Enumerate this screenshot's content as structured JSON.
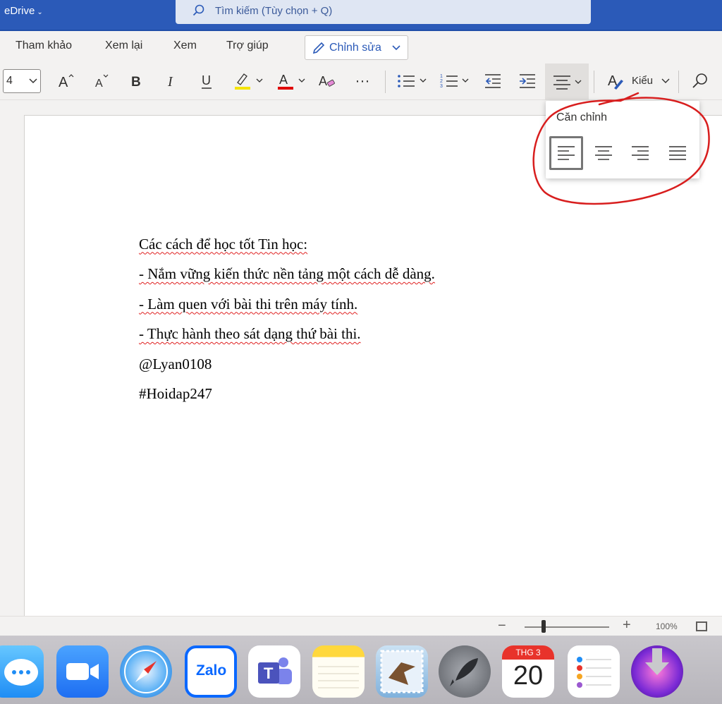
{
  "titlebar": {
    "app_name": "eDrive",
    "search_placeholder": "Tìm kiếm (Tùy chọn + Q)"
  },
  "tabs": [
    "Tham khảo",
    "Xem lại",
    "Xem",
    "Trợ giúp"
  ],
  "edit_mode": {
    "label": "Chỉnh sửa"
  },
  "toolbar": {
    "font_size": "4",
    "more_label": "···",
    "styles_label": "Kiểu"
  },
  "alignment_popup": {
    "title": "Căn chỉnh",
    "options": [
      "align-left",
      "align-center",
      "align-right",
      "justify"
    ],
    "selected": "align-left"
  },
  "document": {
    "lines": [
      "Các cách để học tốt Tin học:",
      "- Nắm vững kiến thức nền tảng một cách dễ dàng.",
      "- Làm quen với bài thi trên máy tính.",
      "- Thực hành theo sát dạng thứ bài thi.",
      "@Lyan0108",
      "#Hoidap247"
    ]
  },
  "status": {
    "zoom_label": "100%",
    "zoom_level_percent": 100
  },
  "dock": {
    "apps": [
      "Messages",
      "Zoom",
      "Safari",
      "Zalo",
      "Teams",
      "Notes",
      "Mail",
      "Launchpad",
      "Calendar",
      "Reminders",
      "Downloader"
    ],
    "zalo_label": "Zalo",
    "calendar_month": "THG 3",
    "calendar_day": "20"
  },
  "colors": {
    "brand": "#2b5ab8",
    "highlight": "#f5e400",
    "font_color": "#e00000",
    "annotation": "#d81e1e"
  }
}
